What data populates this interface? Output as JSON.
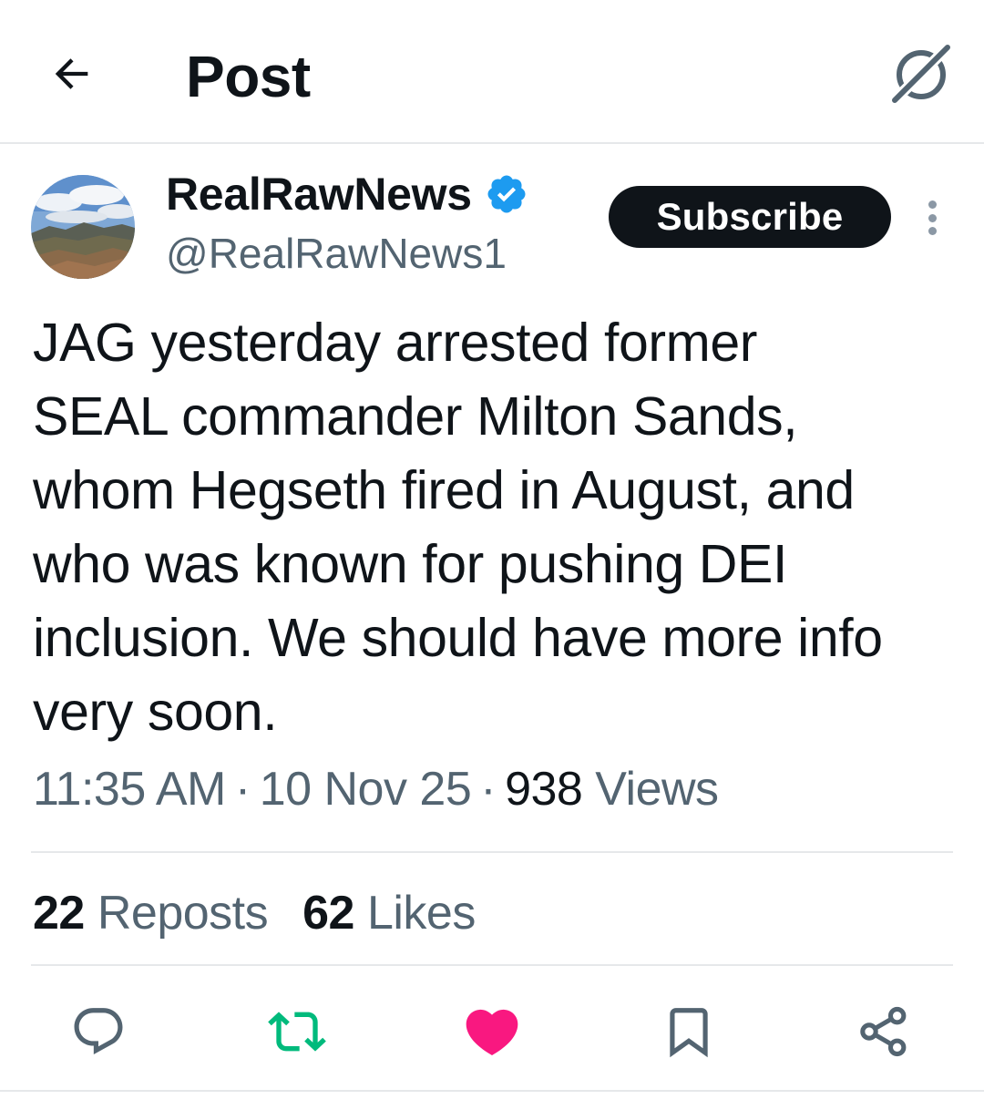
{
  "header": {
    "title": "Post",
    "back_icon": "arrow-left-icon",
    "grok_icon": "grok-icon"
  },
  "author": {
    "display_name": "RealRawNews",
    "handle": "@RealRawNews1",
    "verified_icon": "verified-badge-icon",
    "subscribe_label": "Subscribe",
    "more_icon": "more-vertical-icon"
  },
  "post": {
    "text": "JAG yesterday arrested former\nSEAL commander Milton Sands,\nwhom Hegseth fired in August, and\nwho was known for pushing DEI\ninclusion. We should have more info\nvery soon.",
    "time": "11:35 AM",
    "date": "10 Nov 25",
    "views_count": "938",
    "views_label": "Views",
    "separator": "·"
  },
  "stats": {
    "reposts_count": "22",
    "reposts_label": "Reposts",
    "likes_count": "62",
    "likes_label": "Likes"
  },
  "actions": [
    {
      "name": "reply",
      "icon": "reply-icon"
    },
    {
      "name": "repost",
      "icon": "repost-icon",
      "active": true
    },
    {
      "name": "like",
      "icon": "heart-icon",
      "active": true
    },
    {
      "name": "bookmark",
      "icon": "bookmark-icon"
    },
    {
      "name": "share",
      "icon": "share-icon"
    }
  ],
  "colors": {
    "text_primary": "#0f1419",
    "text_secondary": "#536471",
    "verified_blue": "#1d9bf0",
    "repost_green": "#00ba7c",
    "like_pink": "#f91880",
    "divider": "#e6e8ea"
  }
}
